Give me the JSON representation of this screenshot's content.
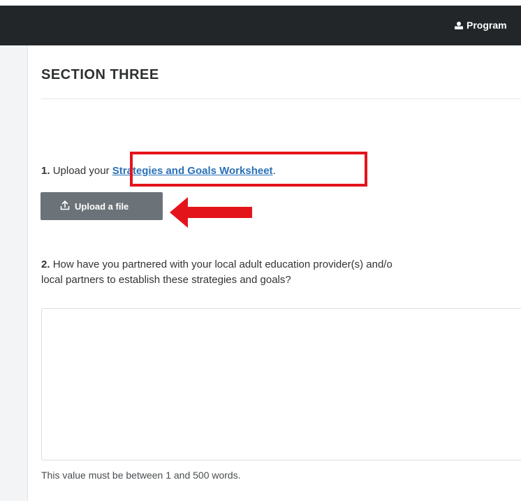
{
  "topbar": {
    "menu_label": "Program",
    "menu_icon": "user-group-icon",
    "background": "#222629"
  },
  "section": {
    "title": "SECTION THREE"
  },
  "question1": {
    "number": "1.",
    "text_before": "Upload your",
    "link_label": "Strategies and Goals Worksheet",
    "text_after": "."
  },
  "upload": {
    "label": "Upload a file",
    "icon": "upload-icon"
  },
  "question2": {
    "number": "2.",
    "line1": "How have you partnered with your local adult education provider(s) and/o",
    "line2": "local partners to establish these strategies and goals?"
  },
  "answer": {
    "value": "",
    "help_text": "This value must be between 1 and 500 words."
  },
  "annotations": {
    "highlight_color": "#e4141b",
    "arrow_color": "#e4141b"
  }
}
